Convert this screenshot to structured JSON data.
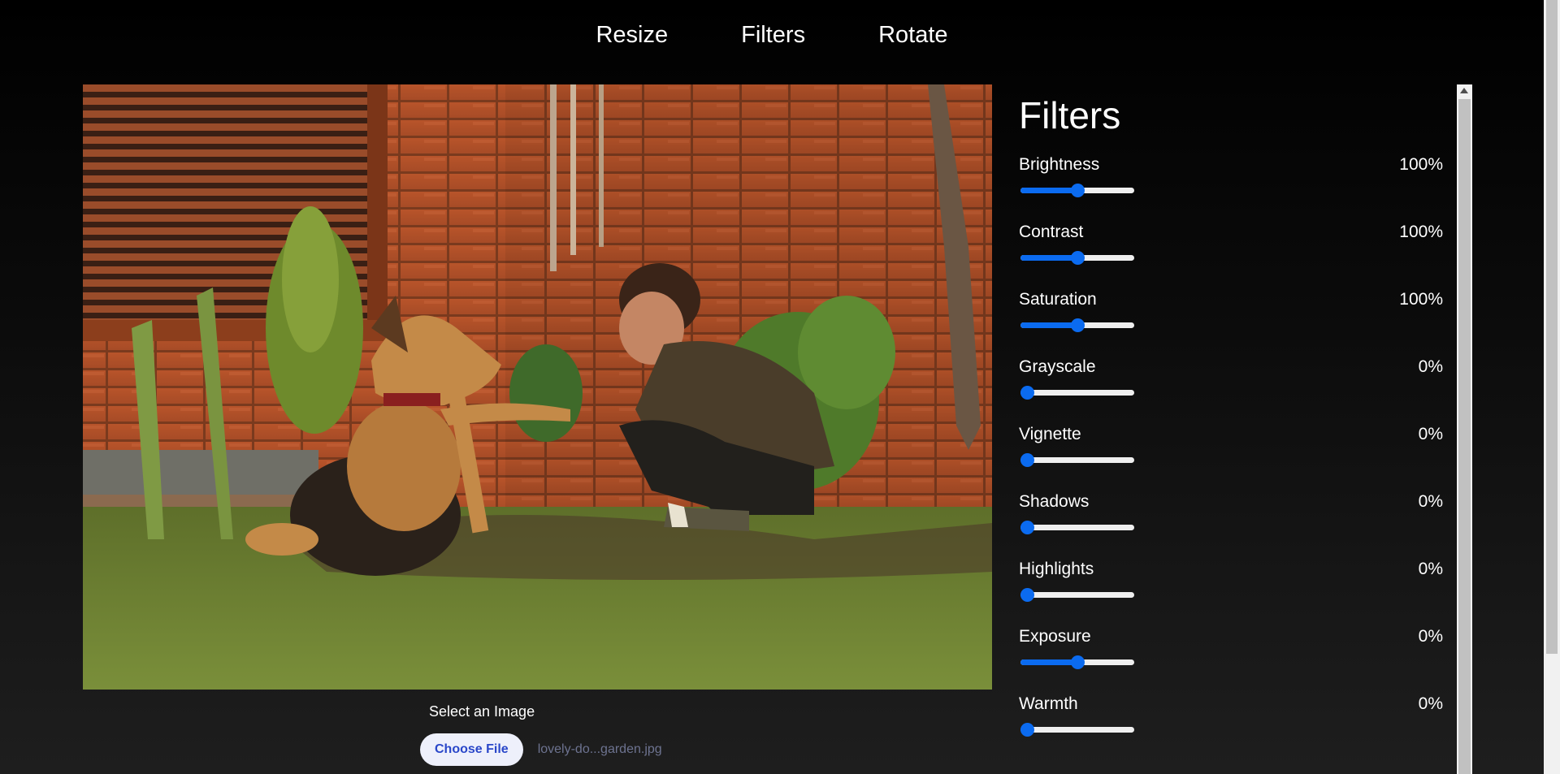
{
  "nav": {
    "items": [
      "Resize",
      "Filters",
      "Rotate"
    ]
  },
  "upload": {
    "label": "Select an Image",
    "button": "Choose File",
    "file_name": "lovely-do...garden.jpg"
  },
  "panel": {
    "title": "Filters",
    "filters": [
      {
        "name": "Brightness",
        "value": "100%",
        "level": 0.5
      },
      {
        "name": "Contrast",
        "value": "100%",
        "level": 0.5
      },
      {
        "name": "Saturation",
        "value": "100%",
        "level": 0.5
      },
      {
        "name": "Grayscale",
        "value": "0%",
        "level": 0
      },
      {
        "name": "Vignette",
        "value": "0%",
        "level": 0
      },
      {
        "name": "Shadows",
        "value": "0%",
        "level": 0
      },
      {
        "name": "Highlights",
        "value": "0%",
        "level": 0
      },
      {
        "name": "Exposure",
        "value": "0%",
        "level": 0.5
      },
      {
        "name": "Warmth",
        "value": "0%",
        "level": 0
      }
    ]
  },
  "colors": {
    "accent": "#0b6bf0",
    "background": "#000000"
  }
}
